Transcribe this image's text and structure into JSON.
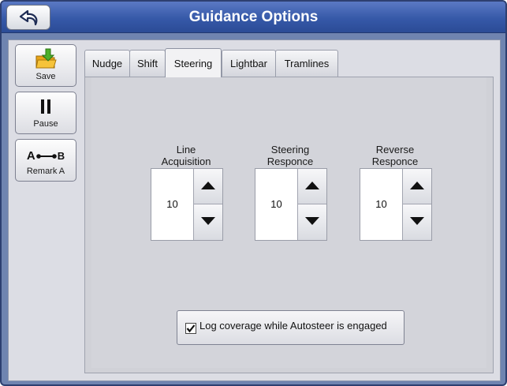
{
  "window": {
    "title": "Guidance Options",
    "back_icon": "back-arrow-icon"
  },
  "sidebar": {
    "items": [
      {
        "label": "Save",
        "icon": "save-folder-icon"
      },
      {
        "label": "Pause",
        "icon": "pause-icon"
      },
      {
        "label": "Remark A",
        "icon": "ab-line-icon",
        "icon_text_a": "A",
        "icon_text_b": "B"
      }
    ]
  },
  "tabs": [
    {
      "label": "Nudge",
      "active": false
    },
    {
      "label": "Shift",
      "active": false
    },
    {
      "label": "Steering",
      "active": true
    },
    {
      "label": "Lightbar",
      "active": false
    },
    {
      "label": "Tramlines",
      "active": false
    }
  ],
  "steering": {
    "spinners": [
      {
        "label_line1": "Line",
        "label_line2": "Acquisition",
        "value": "10"
      },
      {
        "label_line1": "Steering",
        "label_line2": "Responce",
        "value": "10"
      },
      {
        "label_line1": "Reverse",
        "label_line2": "Responce",
        "value": "10"
      }
    ],
    "log_coverage": {
      "label": "Log coverage while Autosteer is engaged",
      "checked": true
    }
  },
  "colors": {
    "titlebar": "#3659a8",
    "frame": "#6f84b0",
    "save_arrow": "#4caf2a",
    "save_folder": "#f2b11c"
  }
}
